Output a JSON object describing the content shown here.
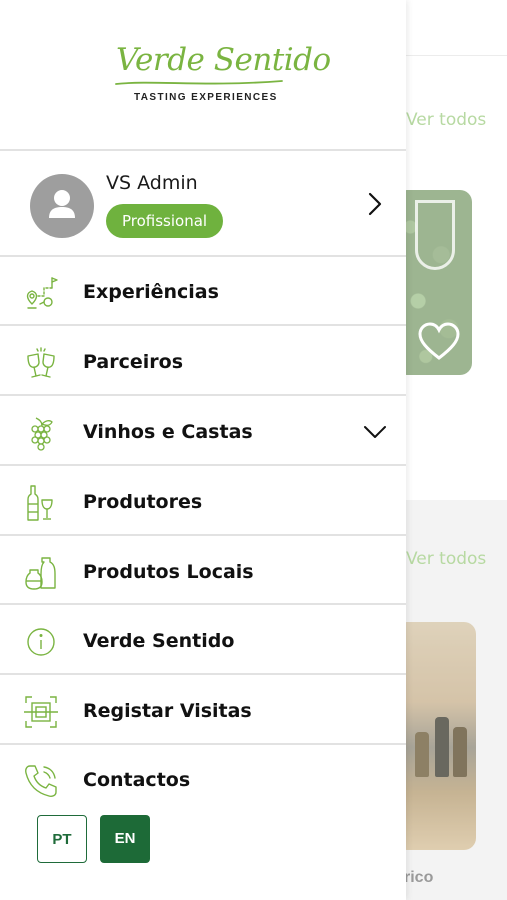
{
  "background": {
    "see_all_1": "Ver todos",
    "see_all_2": "Ver todos",
    "partial_text": "rico"
  },
  "logo": {
    "script": "Verde Sentido",
    "tagline": "TASTING EXPERIENCES"
  },
  "profile": {
    "name": "VS Admin",
    "badge": "Profissional"
  },
  "menu": [
    {
      "label": "Experiências",
      "icon": "map-route-icon"
    },
    {
      "label": "Parceiros",
      "icon": "toast-glasses-icon"
    },
    {
      "label": "Vinhos e Castas",
      "icon": "grapes-icon",
      "expandable": true
    },
    {
      "label": "Produtores",
      "icon": "wine-bottle-glass-icon"
    },
    {
      "label": "Produtos Locais",
      "icon": "jars-icon"
    },
    {
      "label": "Verde Sentido",
      "icon": "info-icon"
    },
    {
      "label": "Registar Visitas",
      "icon": "qr-scan-icon"
    },
    {
      "label": "Contactos",
      "icon": "phone-icon"
    }
  ],
  "languages": [
    {
      "code": "PT",
      "selected": false
    },
    {
      "code": "EN",
      "selected": true
    }
  ],
  "colors": {
    "brand_green": "#7ab441",
    "badge_green": "#6fb23e",
    "dark_green": "#1d6a37"
  }
}
